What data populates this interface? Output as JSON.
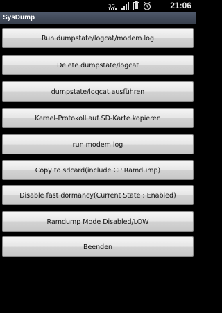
{
  "status_bar": {
    "time": "21:06",
    "network_label": "3G",
    "icons": [
      "network-3g-icon",
      "signal-icon",
      "battery-icon",
      "alarm-icon"
    ]
  },
  "app": {
    "title": "SysDump"
  },
  "buttons": [
    {
      "label": "Run dumpstate/logcat/modem log"
    },
    {
      "label": "Delete dumpstate/logcat"
    },
    {
      "label": "dumpstate/logcat ausführen"
    },
    {
      "label": "Kernel-Protokoll auf SD-Karte kopieren"
    },
    {
      "label": "run modem log"
    },
    {
      "label": "Copy to sdcard(include CP Ramdump)"
    },
    {
      "label": "Disable fast dormancy(Current State : Enabled)"
    },
    {
      "label": "Ramdump Mode Disabled/LOW"
    },
    {
      "label": "Beenden"
    }
  ],
  "colors": {
    "title_bar": "#444c5a",
    "background": "#000000",
    "button": "#e0e0e0"
  }
}
